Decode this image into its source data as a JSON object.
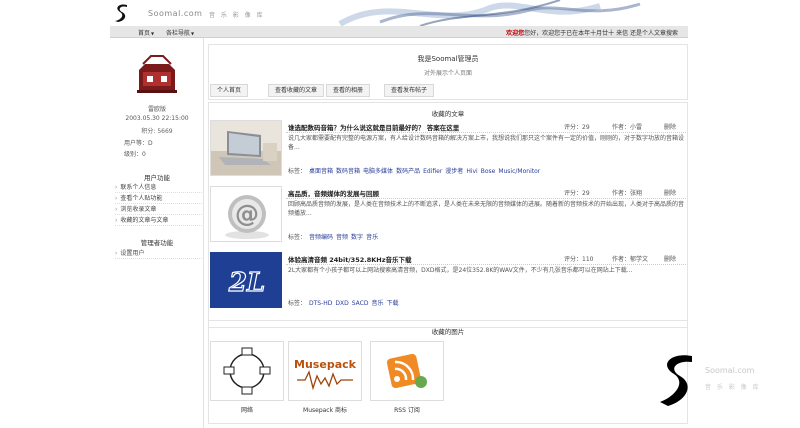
{
  "header": {
    "site_name": "Soomal.com",
    "slogan": "音 乐 影 像 库"
  },
  "nav": {
    "home": "首页",
    "tech": "各栏导航",
    "notice_red": "欢迎您",
    "notice_text": "您好，欢迎您于已在本年十月廿十 来信 还是个人文章搜索"
  },
  "user": {
    "name": "雷欧版",
    "date": "2003.05.30 22:15:00",
    "score": "积分: 5669",
    "group": "用户等：D",
    "level": "级别：0"
  },
  "sidebar": {
    "functions_title": "用户功能",
    "functions": [
      "联系个人信息",
      "查看个人贴功能",
      "浏览收录文章",
      "收藏的文章与文章"
    ],
    "admin_title": "管理者功能",
    "admin": [
      "设置用户"
    ]
  },
  "main": {
    "title": "我是Soomal管理员",
    "subtitle": "对外展示个人页面",
    "tabs": [
      "个人首页",
      "查看收藏的文章",
      "查看的相册",
      "查看发布帖子"
    ],
    "articles_title": "收藏的文章",
    "articles": [
      {
        "title": "谁选配数码音箱？为什么说这就是目前最好的？ 答案在这里",
        "score": "评分：29",
        "author": "作者：小雷",
        "action": "删除",
        "body": "说几大家都需要配有完整的电源方案，有人给设计数码音箱的解决方案上市，我想说我们那只这个案件有一定的价值，刚刚的，对于数字功放的音箱设备...",
        "tags_label": "标签：",
        "tags": [
          "桌面音箱",
          "数码音箱",
          "电脑多媒体",
          "数码产品",
          "Edifier",
          "漫步者",
          "Hivi",
          "Bose",
          "Music/Monitor"
        ]
      },
      {
        "title": "高品质，音频媒体的发展与回顾",
        "score": "评分：29",
        "author": "作者：张翔",
        "action": "删除",
        "body": "回顾高品质音频的发展，是人类在音频技术上的不断追求，是人类在未来无限的音频媒体的进展。随着新的音频技术的开始出现，人类对于高品质的音频播放...",
        "tags_label": "标签：",
        "tags": [
          "音频编码",
          "音频",
          "数字",
          "音乐"
        ]
      },
      {
        "title": "体验高清音频 24bit/352.8KHz音乐下载",
        "score": "评分：110",
        "author": "作者：郁学文",
        "action": "删除",
        "body": "2L大家都有个小孩子都可以上网站搜索高清音频，DXD格式，是24位352.8K的WAV文件，不少有几张音乐都可以在网站上下载...",
        "tags_label": "标签：",
        "tags": [
          "DTS-HD",
          "DXD",
          "SACD",
          "音乐",
          "下载"
        ]
      }
    ],
    "photos_title": "收藏的图片",
    "photos": [
      "网络",
      "Musepack 商标",
      "RSS 订阅"
    ]
  },
  "corner": {
    "site": "Soomal.com",
    "slogan": "音 乐 影 像 库"
  },
  "colors": {
    "nav_bg": "#e6e6e6",
    "link_blue": "#2a3d9a",
    "notice_red": "#c00000"
  }
}
